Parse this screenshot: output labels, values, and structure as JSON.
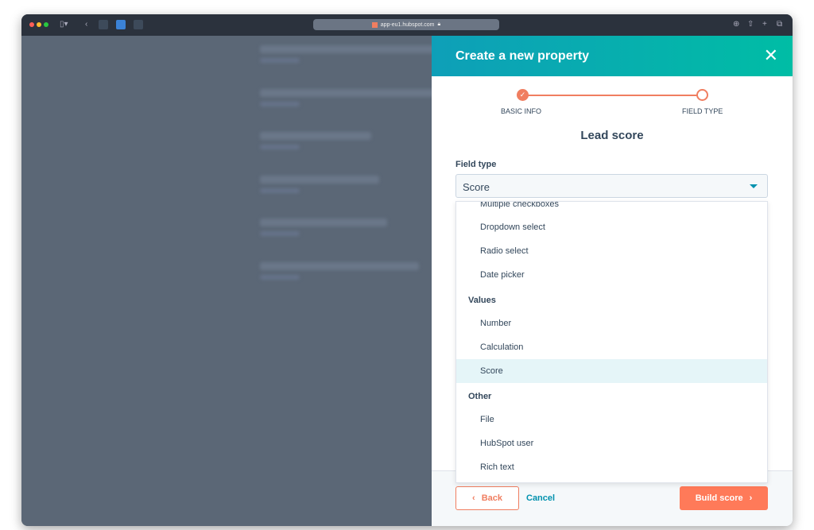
{
  "browser": {
    "url": "app-eu1.hubspot.com"
  },
  "panel": {
    "title": "Create a new property",
    "steps": [
      {
        "label": "BASIC INFO",
        "status": "complete"
      },
      {
        "label": "FIELD TYPE",
        "status": "current"
      }
    ],
    "property_name": "Lead score",
    "field_type_label": "Field type",
    "field_type_value": "Score",
    "options": {
      "partial": "Multiple checkboxes",
      "choices": [
        "Dropdown select",
        "Radio select",
        "Date picker"
      ],
      "values_group": "Values",
      "values": [
        "Number",
        "Calculation",
        "Score"
      ],
      "other_group": "Other",
      "other": [
        "File",
        "HubSpot user",
        "Rich text"
      ]
    },
    "selected_option": "Score",
    "back_label": "Back",
    "cancel_label": "Cancel",
    "build_label": "Build score"
  },
  "colors": {
    "accent": "#ff7a59",
    "teal": "#00bda5",
    "link": "#0091ae"
  }
}
